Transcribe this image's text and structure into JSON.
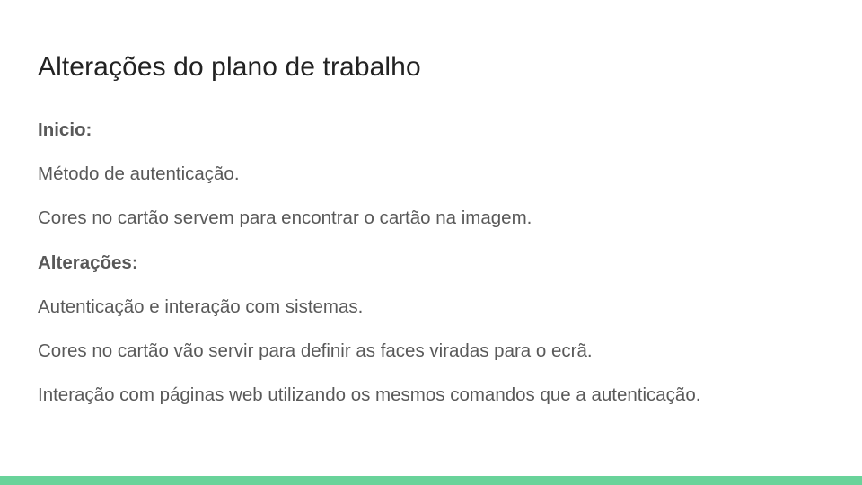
{
  "slide": {
    "title": "Alterações do plano de trabalho",
    "lines": [
      {
        "text": "Inicio:",
        "bold": true
      },
      {
        "text": "Método de autenticação.",
        "bold": false
      },
      {
        "text": "Cores no cartão servem para encontrar o cartão na imagem.",
        "bold": false
      },
      {
        "text": "Alterações:",
        "bold": true
      },
      {
        "text": "Autenticação e interação com sistemas.",
        "bold": false
      },
      {
        "text": "Cores no cartão vão servir para definir as faces viradas para o ecrã.",
        "bold": false
      },
      {
        "text": "Interação com páginas web utilizando os mesmos comandos que a autenticação.",
        "bold": false
      }
    ]
  },
  "colors": {
    "title": "#222222",
    "body_text": "#595959",
    "accent_bar": "#69d39a",
    "background": "#ffffff"
  }
}
